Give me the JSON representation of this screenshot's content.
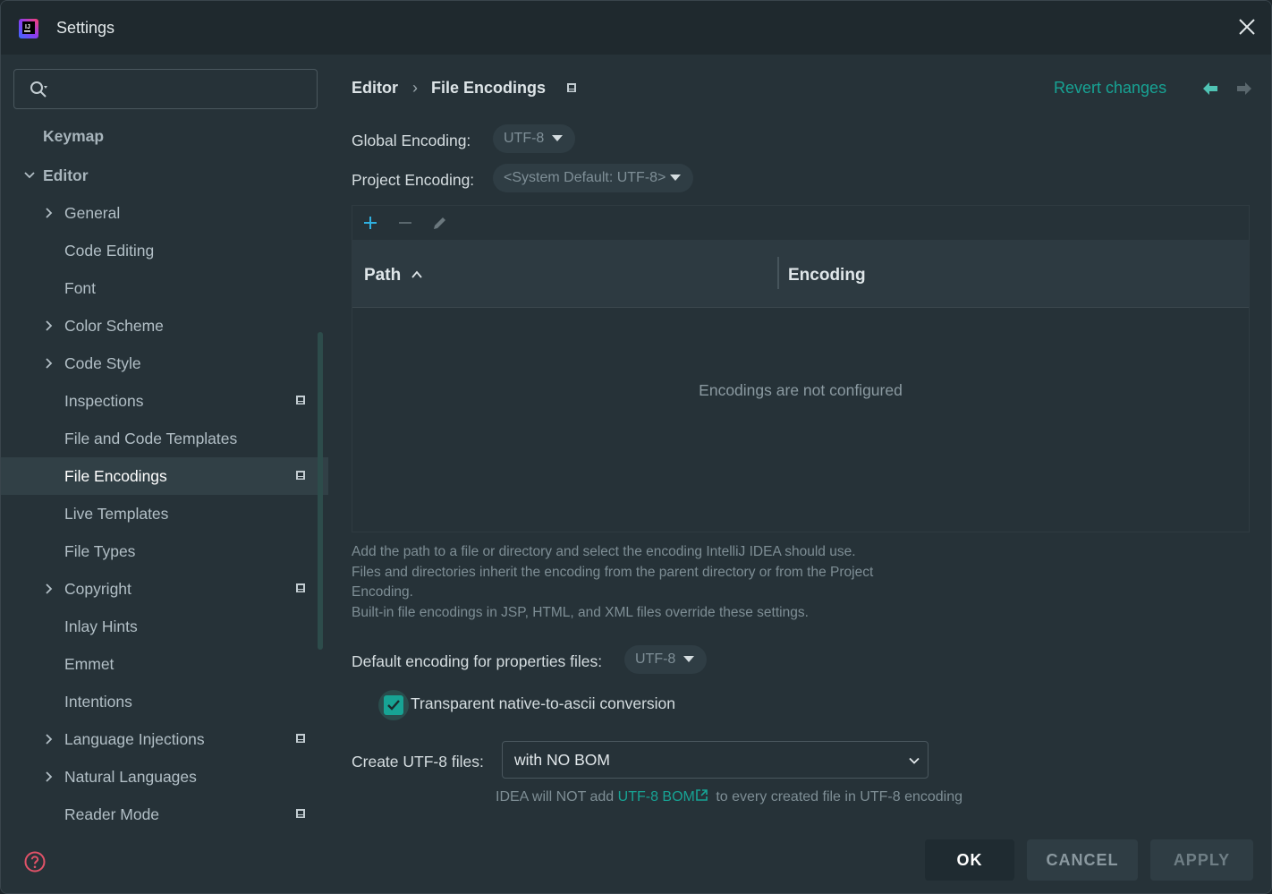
{
  "window": {
    "title": "Settings",
    "app_icon": "intellij-logo",
    "close_icon": "close-icon"
  },
  "colors": {
    "background": "#263238",
    "titlebar": "#1f292e",
    "accent": "#17a394",
    "selected_row": "#314046",
    "text": "#c3cdd2"
  },
  "sidebar": {
    "search": {
      "placeholder": "",
      "value": ""
    },
    "items": [
      {
        "label": "Keymap",
        "level": 0,
        "expandable": false,
        "badge": false
      },
      {
        "label": "Editor",
        "level": 0,
        "expandable": true,
        "expanded": true,
        "badge": false
      },
      {
        "label": "General",
        "level": 1,
        "expandable": true,
        "badge": false
      },
      {
        "label": "Code Editing",
        "level": 1,
        "expandable": false,
        "badge": false
      },
      {
        "label": "Font",
        "level": 1,
        "expandable": false,
        "badge": false
      },
      {
        "label": "Color Scheme",
        "level": 1,
        "expandable": true,
        "badge": false
      },
      {
        "label": "Code Style",
        "level": 1,
        "expandable": true,
        "badge": false
      },
      {
        "label": "Inspections",
        "level": 1,
        "expandable": false,
        "badge": true
      },
      {
        "label": "File and Code Templates",
        "level": 1,
        "expandable": false,
        "badge": false
      },
      {
        "label": "File Encodings",
        "level": 1,
        "expandable": false,
        "badge": true,
        "selected": true
      },
      {
        "label": "Live Templates",
        "level": 1,
        "expandable": false,
        "badge": false
      },
      {
        "label": "File Types",
        "level": 1,
        "expandable": false,
        "badge": false
      },
      {
        "label": "Copyright",
        "level": 1,
        "expandable": true,
        "badge": true
      },
      {
        "label": "Inlay Hints",
        "level": 1,
        "expandable": false,
        "badge": false
      },
      {
        "label": "Emmet",
        "level": 1,
        "expandable": false,
        "badge": false
      },
      {
        "label": "Intentions",
        "level": 1,
        "expandable": false,
        "badge": false
      },
      {
        "label": "Language Injections",
        "level": 1,
        "expandable": true,
        "badge": true
      },
      {
        "label": "Natural Languages",
        "level": 1,
        "expandable": true,
        "badge": false
      },
      {
        "label": "Reader Mode",
        "level": 1,
        "expandable": false,
        "badge": true
      }
    ],
    "help_icon": "help-icon"
  },
  "header": {
    "breadcrumb_parent": "Editor",
    "breadcrumb_separator": "›",
    "breadcrumb_current": "File Encodings",
    "revert_label": "Revert changes"
  },
  "encodings": {
    "global_label": "Global Encoding:",
    "global_value": "UTF-8",
    "project_label": "Project Encoding:",
    "project_value": "<System Default: UTF-8>"
  },
  "table": {
    "columns": [
      "Path",
      "Encoding"
    ],
    "sorted_column": "Path",
    "sort_direction": "ascending",
    "rows": [],
    "empty_text": "Encodings are not configured"
  },
  "hint": {
    "lines": [
      "Add the path to a file or directory and select the encoding IntelliJ IDEA should use.",
      "Files and directories inherit the encoding from the parent directory or from the Project",
      "Encoding.",
      "Built-in file encodings in JSP, HTML, and XML files override these settings."
    ]
  },
  "properties": {
    "label": "Default encoding for properties files:",
    "value": "UTF-8",
    "native_to_ascii_label": "Transparent native-to-ascii conversion",
    "native_to_ascii_checked": true
  },
  "bom": {
    "label": "Create UTF-8 files:",
    "value": "with NO BOM",
    "note_prefix": "IDEA will NOT add",
    "note_link": "UTF-8 BOM",
    "note_suffix": "to every created file in UTF-8 encoding"
  },
  "buttons": {
    "ok": "OK",
    "cancel": "CANCEL",
    "apply": "APPLY"
  }
}
